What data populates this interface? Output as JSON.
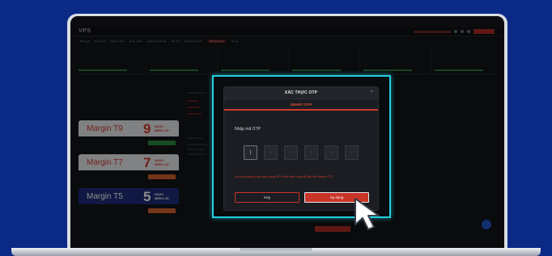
{
  "app": {
    "logo": "VPS"
  },
  "nav": {
    "items": [
      {
        "label": "Bảng giá",
        "active": false
      },
      {
        "label": "Thị trường",
        "active": false
      },
      {
        "label": "Quản lý lệnh",
        "active": false
      },
      {
        "label": "Quản lý tiền",
        "active": false
      },
      {
        "label": "Quản lý tài khoản",
        "active": false
      },
      {
        "label": "Tiện ích",
        "active": false
      },
      {
        "label": "Dịch vụ tài chính",
        "active": false
      },
      {
        "label": "Mở tài khoản",
        "active": true
      },
      {
        "label": "Hỗ trợ",
        "active": false
      }
    ]
  },
  "left_panel": {
    "cards": [
      {
        "title": "Margin T9",
        "number": "9",
        "tag_line1": "NGÀY",
        "tag_line2": "MIỄN LÃI",
        "button_color": "#2b8a3e",
        "banner_color": "#e9ecef",
        "number_color": "#d13b2c",
        "tag_color": "#d13b2c"
      },
      {
        "title": "Margin T7",
        "number": "7",
        "tag_line1": "NGÀY",
        "tag_line2": "MIỄN LÃI",
        "button_color": "#d3632c",
        "banner_color": "#e9ecef",
        "number_color": "#d13b2c",
        "tag_color": "#d13b2c"
      },
      {
        "title": "Margin T5",
        "number": "5",
        "tag_line1": "NGÀY",
        "tag_line2": "MIỄN LÃI",
        "button_color": "#d3632c",
        "banner_color": "#1e2f7a",
        "number_color": "#ffffff",
        "tag_color": "#ffffff"
      }
    ]
  },
  "modal": {
    "title": "XÁC THỰC OTP",
    "tab": "SMART OTP",
    "otp_label": "Nhập mã OTP",
    "otp_placeholders": [
      "|",
      "-",
      "-",
      "-",
      "-",
      "-"
    ],
    "note": "Vui lòng đăng nhập ứng dụng VPS trên điện thoại để lấy mã Smart OTP",
    "cancel_label": "Hủy",
    "apply_label": "Áp dụng"
  },
  "colors": {
    "accent": "#d33a2c",
    "highlight": "#24cfe0",
    "background": "#0b2a86"
  }
}
